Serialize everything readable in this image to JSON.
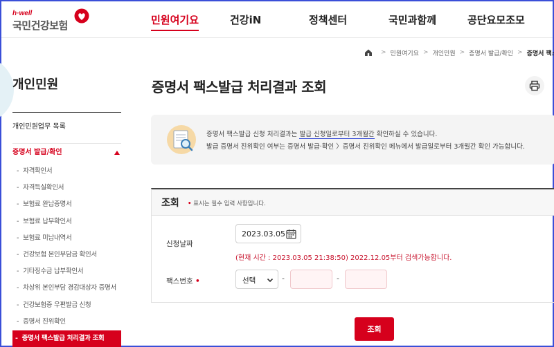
{
  "logo": {
    "tagline": "h·well",
    "name": "국민건강보험"
  },
  "gnb": [
    {
      "label": "민원여기요",
      "active": true
    },
    {
      "label": "건강iN",
      "active": false
    },
    {
      "label": "정책센터",
      "active": false
    },
    {
      "label": "국민과함께",
      "active": false
    },
    {
      "label": "공단요모조모",
      "active": false
    }
  ],
  "breadcrumb": [
    "민원여기요",
    "개인민원",
    "증명서 발급/확인",
    "증명서 팩스발"
  ],
  "sidebar": {
    "title": "개인민원",
    "menu_top": "개인민원업무 목록",
    "menu_open": "증명서 발급/확인",
    "items": [
      "자격확인서",
      "자격득실확인서",
      "보험료 완납증명서",
      "보험료 납부확인서",
      "보험료 미납내역서",
      "건강보험 본인부담금 확인서",
      "기타징수금 납부확인서",
      "차상위 본인부담 경감대상자 증명서",
      "건강보험증 우편발급 신청",
      "증명서 진위확인",
      "증명서 팩스발급 처리결과 조회"
    ],
    "active_index": 10
  },
  "page": {
    "title": "증명서 팩스발급 처리결과 조회"
  },
  "info": {
    "line1_a": "증명서 팩스발급 신청 처리결과는 ",
    "line1_b": "발급 신청일로부터 3개월간",
    "line1_c": " 확인하실 수 있습니다.",
    "line2": "발급 증명서 진위확인 여부는 증명서 발급·확인 〉증명서 진위확인 메뉴에서 발급일로부터 3개월간 확인 가능합니다."
  },
  "form": {
    "title": "조회",
    "required_note": "표시는 필수 입력 사항입니다.",
    "date_label": "신청날짜",
    "date_value": "2023.03.05",
    "date_note": "(현재 시간 : 2023.03.05 21:38:50) 2022.12.05부터 검색가능합니다.",
    "fax_label": "팩스번호",
    "fax_select": "선택",
    "search_button": "조회"
  },
  "colors": {
    "accent": "#d6001c",
    "frame": "#3a4fd8"
  }
}
